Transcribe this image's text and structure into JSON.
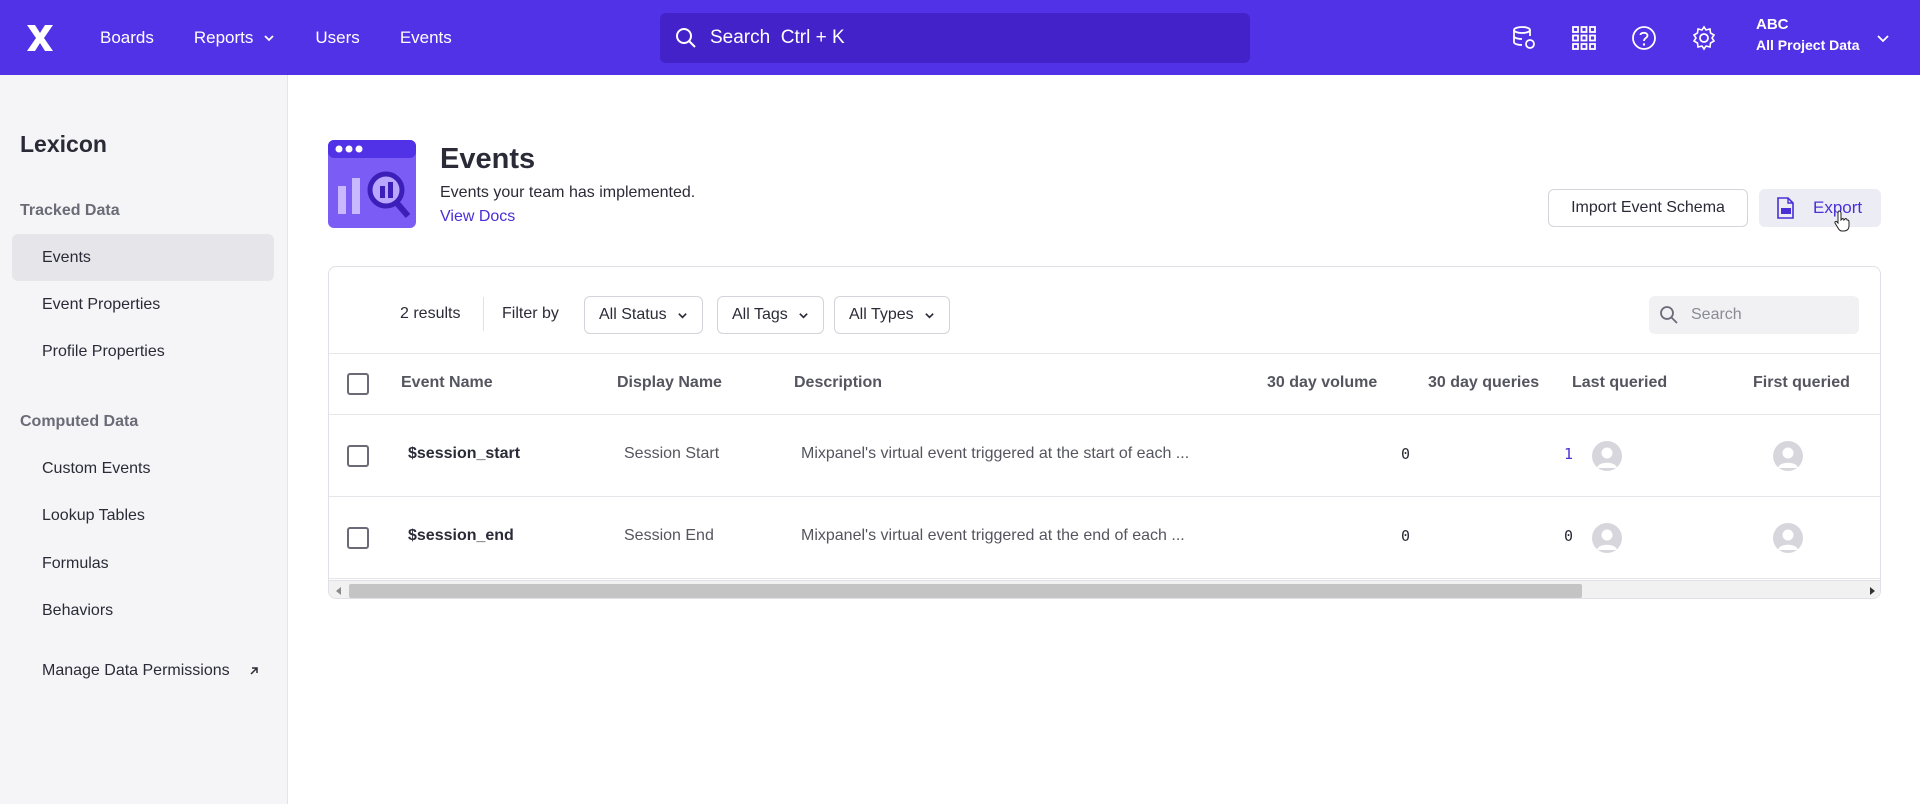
{
  "topnav": {
    "items": [
      {
        "label": "Boards",
        "has_dropdown": false
      },
      {
        "label": "Reports",
        "has_dropdown": true
      },
      {
        "label": "Users",
        "has_dropdown": false
      },
      {
        "label": "Events",
        "has_dropdown": false
      }
    ],
    "search_placeholder": "Search  Ctrl + K",
    "icons": [
      "data-settings-icon",
      "apps-grid-icon",
      "help-icon",
      "gear-icon"
    ],
    "project": {
      "org": "ABC",
      "name": "All Project Data"
    }
  },
  "sidebar": {
    "title": "Lexicon",
    "sections": [
      {
        "label": "Tracked Data",
        "items": [
          {
            "label": "Events",
            "active": true
          },
          {
            "label": "Event Properties",
            "active": false
          },
          {
            "label": "Profile Properties",
            "active": false
          }
        ]
      },
      {
        "label": "Computed Data",
        "items": [
          {
            "label": "Custom Events",
            "active": false
          },
          {
            "label": "Lookup Tables",
            "active": false
          },
          {
            "label": "Formulas",
            "active": false
          },
          {
            "label": "Behaviors",
            "active": false
          }
        ]
      }
    ],
    "footer_link": "Manage Data Permissions"
  },
  "header": {
    "title": "Events",
    "subtitle": "Events your team has implemented.",
    "docs_link": "View Docs",
    "import_label": "Import Event Schema",
    "export_label": "Export"
  },
  "toolbar": {
    "results": "2 results",
    "filter_by": "Filter by",
    "filters": [
      "All Status",
      "All Tags",
      "All Types"
    ],
    "search_placeholder": "Search"
  },
  "table": {
    "columns": [
      "Event Name",
      "Display Name",
      "Description",
      "30 day volume",
      "30 day queries",
      "Last queried",
      "First queried"
    ],
    "rows": [
      {
        "event_name": "$session_start",
        "display_name": "Session Start",
        "description": "Mixpanel's virtual event triggered at the start of each ...",
        "volume": "0",
        "queries": "1"
      },
      {
        "event_name": "$session_end",
        "display_name": "Session End",
        "description": "Mixpanel's virtual event triggered at the end of each ...",
        "volume": "0",
        "queries": "0"
      }
    ]
  },
  "colors": {
    "brand": "#5232e6",
    "accent": "#4a2fd6"
  }
}
